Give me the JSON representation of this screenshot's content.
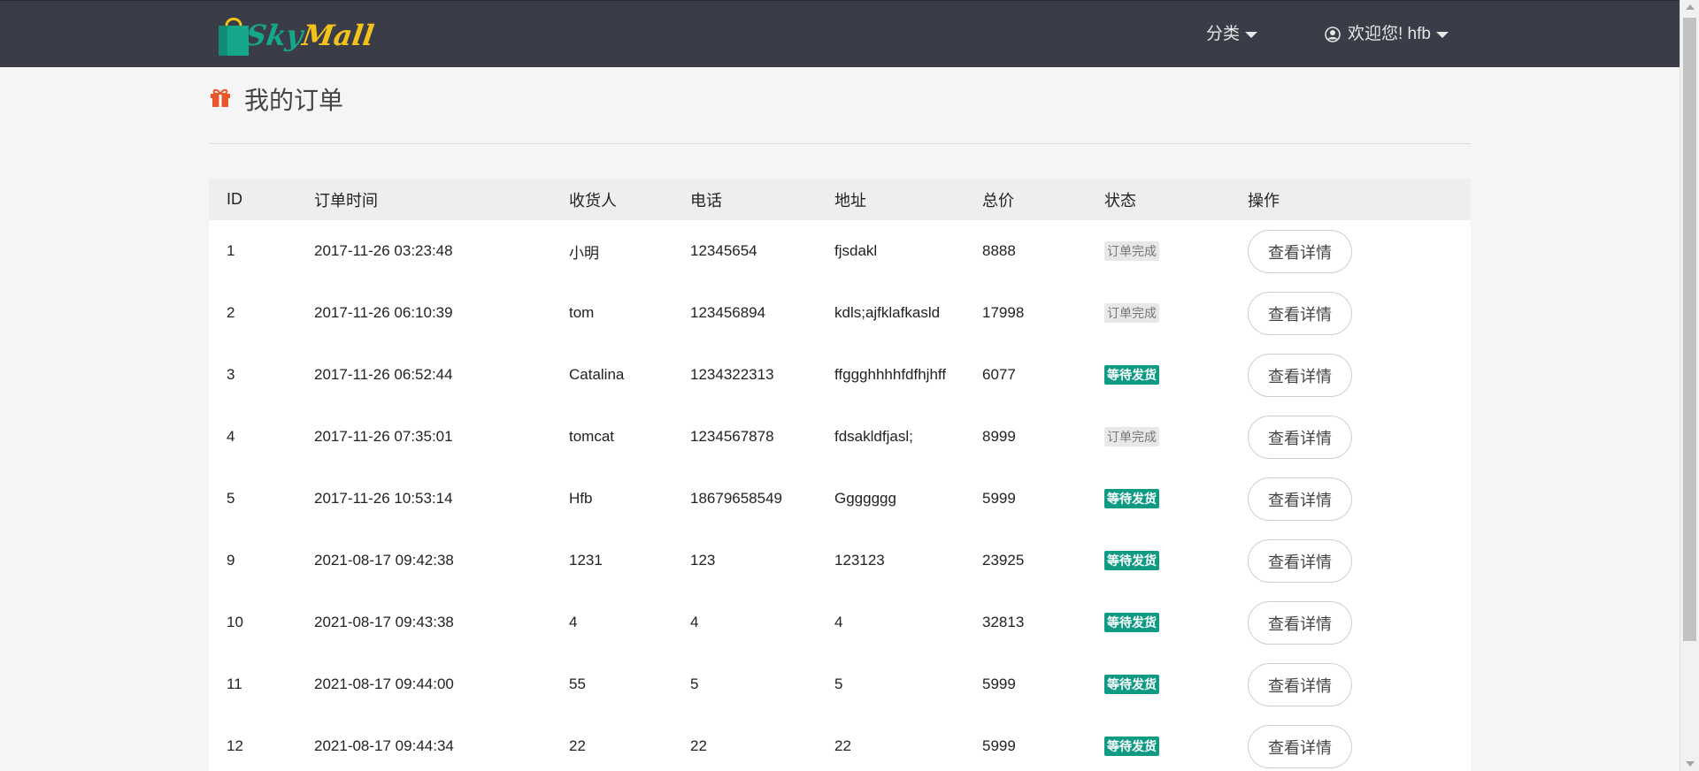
{
  "header": {
    "logo_text_part1": "Sky",
    "logo_text_part2": "Mall",
    "category_label": "分类",
    "welcome_label": "欢迎您! hfb"
  },
  "page": {
    "title": "我的订单"
  },
  "table": {
    "headers": [
      "ID",
      "订单时间",
      "收货人",
      "电话",
      "地址",
      "总价",
      "状态",
      "操作"
    ],
    "action_label": "查看详情",
    "rows": [
      {
        "id": "1",
        "time": "2017-11-26 03:23:48",
        "receiver": "小明",
        "phone": "12345654",
        "address": "fjsdakl",
        "total": "8888",
        "status": "订单完成",
        "status_type": "done"
      },
      {
        "id": "2",
        "time": "2017-11-26 06:10:39",
        "receiver": "tom",
        "phone": "123456894",
        "address": "kdls;ajfklafkasld",
        "total": "17998",
        "status": "订单完成",
        "status_type": "done"
      },
      {
        "id": "3",
        "time": "2017-11-26 06:52:44",
        "receiver": "Catalina",
        "phone": "1234322313",
        "address": "ffggghhhhfdfhjhff",
        "total": "6077",
        "status": "等待发货",
        "status_type": "wait"
      },
      {
        "id": "4",
        "time": "2017-11-26 07:35:01",
        "receiver": "tomcat",
        "phone": "1234567878",
        "address": "fdsakldfjasl;",
        "total": "8999",
        "status": "订单完成",
        "status_type": "done"
      },
      {
        "id": "5",
        "time": "2017-11-26 10:53:14",
        "receiver": "Hfb",
        "phone": "18679658549",
        "address": "Ggggggg",
        "total": "5999",
        "status": "等待发货",
        "status_type": "wait"
      },
      {
        "id": "9",
        "time": "2021-08-17 09:42:38",
        "receiver": "1231",
        "phone": "123",
        "address": "123123",
        "total": "23925",
        "status": "等待发货",
        "status_type": "wait"
      },
      {
        "id": "10",
        "time": "2021-08-17 09:43:38",
        "receiver": "4",
        "phone": "4",
        "address": "4",
        "total": "32813",
        "status": "等待发货",
        "status_type": "wait"
      },
      {
        "id": "11",
        "time": "2021-08-17 09:44:00",
        "receiver": "55",
        "phone": "5",
        "address": "5",
        "total": "5999",
        "status": "等待发货",
        "status_type": "wait"
      },
      {
        "id": "12",
        "time": "2021-08-17 09:44:34",
        "receiver": "22",
        "phone": "22",
        "address": "22",
        "total": "5999",
        "status": "等待发货",
        "status_type": "wait"
      }
    ]
  },
  "colors": {
    "navbar": "#3a3d48",
    "brand_green": "#16a689",
    "brand_yellow": "#f3c21c",
    "status_wait": "#0f9a84",
    "status_done": "#e8e8e8",
    "gift_icon": "#e8572a"
  },
  "icons": [
    "shopping-bag-icon",
    "caret-down-icon",
    "user-circle-icon",
    "gift-icon"
  ]
}
